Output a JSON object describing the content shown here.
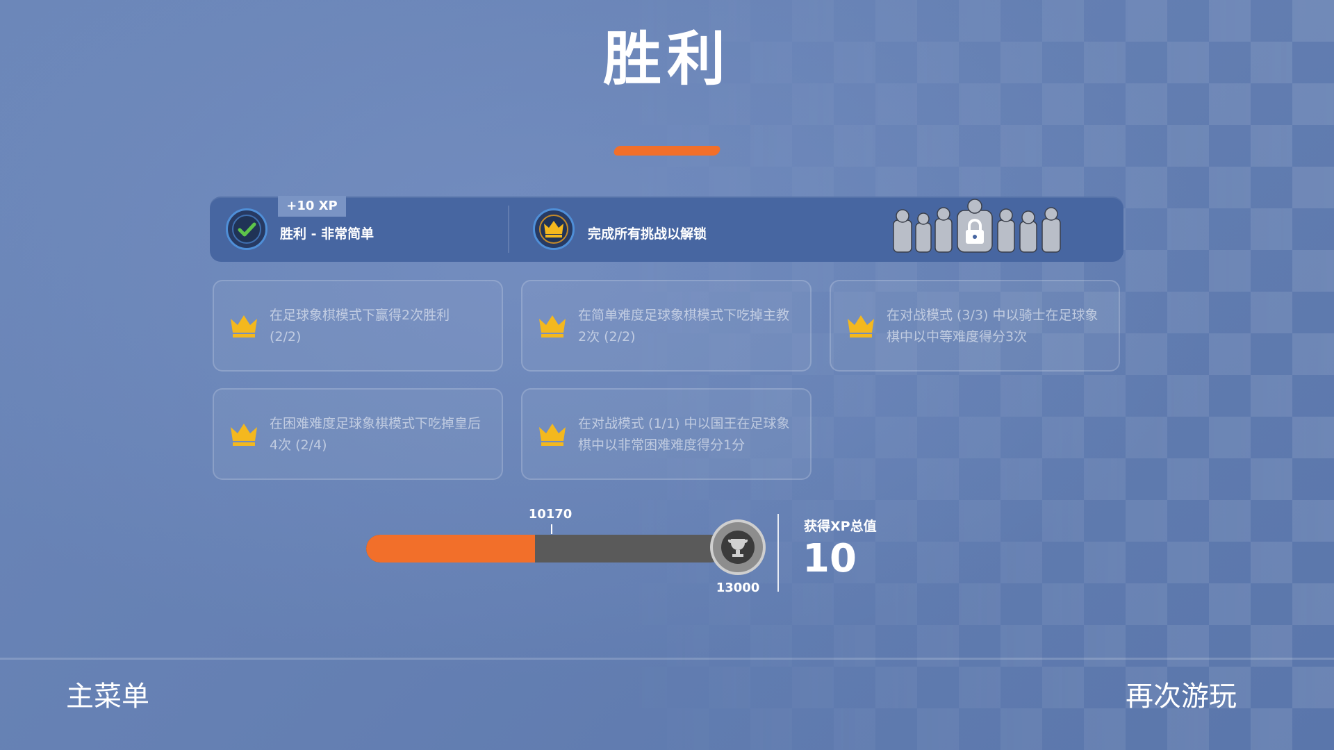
{
  "title": "胜利",
  "summary": {
    "xp_tag": "+10 XP",
    "result_label": "胜利 - 非常简单",
    "unlock_label": "完成所有挑战以解锁"
  },
  "challenges": [
    {
      "text": "在足球象棋模式下赢得2次胜利 (2/2)",
      "icon": "crown-icon"
    },
    {
      "text": "在简单难度足球象棋模式下吃掉主教2次 (2/2)",
      "icon": "crown-icon"
    },
    {
      "text": "在对战模式 (3/3) 中以骑士在足球象棋中以中等难度得分3次",
      "icon": "crown-icon"
    },
    {
      "text": "在困难难度足球象棋模式下吃掉皇后4次 (2/4)",
      "icon": "crown-icon"
    },
    {
      "text": "在对战模式 (1/1) 中以国王在足球象棋中以非常困难难度得分1分",
      "icon": "crown-icon"
    }
  ],
  "progress": {
    "current_label": "10170",
    "max_label": "13000",
    "fill_fraction": 0.47
  },
  "xp_total": {
    "label": "获得XP总值",
    "value": "10"
  },
  "nav": {
    "main_menu": "主菜单",
    "play_again": "再次游玩"
  },
  "colors": {
    "accent": "#f26f2a",
    "banner": "#4766a1",
    "crown": "#f4b81e"
  }
}
